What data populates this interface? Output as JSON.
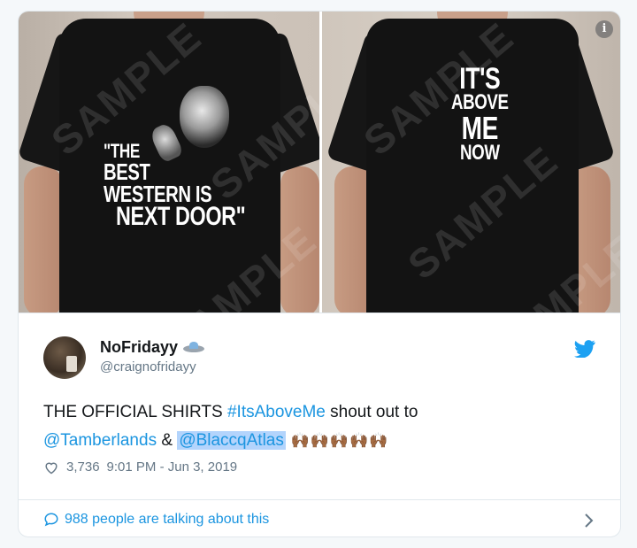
{
  "media": {
    "front_print_lines": [
      "\"THE",
      "BEST",
      "WESTERN IS",
      "NEXT DOOR\""
    ],
    "back_print_lines": [
      "IT'S",
      "ABOVE",
      "ME",
      "NOW"
    ],
    "watermark": "SAMPLE",
    "info_label": "i"
  },
  "tweet": {
    "display_name": "NoFridayy",
    "handle": "@craignofridayy",
    "text_prefix": "THE OFFICIAL SHIRTS ",
    "hashtag": "#ItsAboveMe",
    "text_mid": " shout out to",
    "mention1": "@Tamberlands",
    "ampersand": " & ",
    "mention2": "@BlaccqAtlas",
    "emoji": " 🙌🏾🙌🏾🙌🏾🙌🏾🙌🏾",
    "likes": "3,736",
    "timestamp": "9:01 PM - Jun 3, 2019",
    "talking": "988 people are talking about this"
  },
  "colors": {
    "link": "#1b95e0",
    "muted": "#657786",
    "border": "#e1e8ed"
  }
}
